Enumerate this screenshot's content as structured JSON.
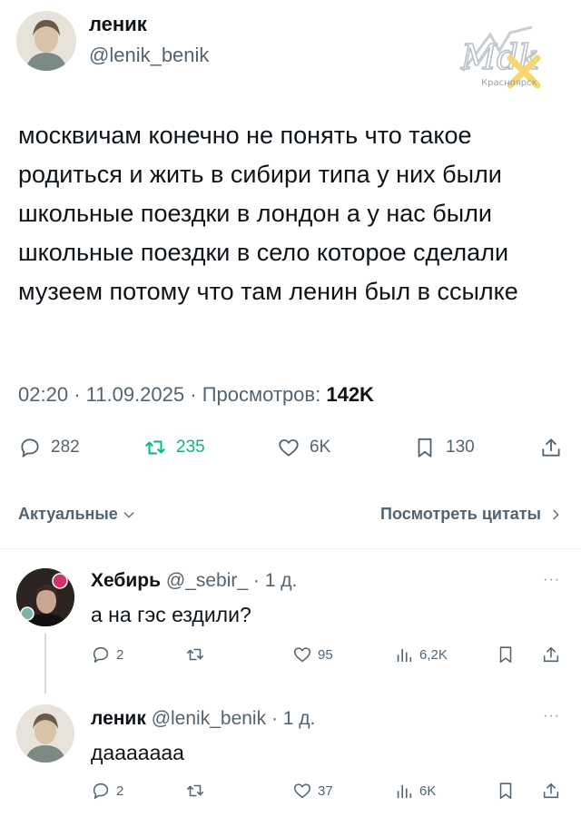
{
  "tweet": {
    "author_name": "леник",
    "author_handle": "@lenik_benik",
    "text": "москвичам конечно не понять что такое родиться и жить в сибири типа у них были школьные поездки в лондон а у нас были школьные поездки в село которое сделали музеем потому что там ленин был в ссылке",
    "time": "02:20",
    "date": "11.09.2025",
    "views_label": "Просмотров:",
    "views_count": "142K",
    "replies": "282",
    "retweets": "235",
    "likes": "6K",
    "bookmarks": "130"
  },
  "logo": {
    "wordmark": "Mdk",
    "city": "Красноярск"
  },
  "sort": {
    "left_label": "Актуальные",
    "right_label": "Посмотреть цитаты"
  },
  "replies": [
    {
      "name": "Хебирь",
      "handle": "@_sebir_",
      "time": "1 д.",
      "text": "а на гэс ездили?",
      "replies": "2",
      "retweets": "",
      "likes": "95",
      "views": "6,2K"
    },
    {
      "name": "леник",
      "handle": "@lenik_benik",
      "time": "1 д.",
      "text": "даааaaaa",
      "replies": "2",
      "retweets": "",
      "likes": "37",
      "views": "6K"
    }
  ],
  "ui": {
    "separator": "·",
    "more": "···"
  },
  "colors": {
    "retweet_active": "#00ba7c",
    "secondary_text": "#536471",
    "logo_accent": "#f5d76e"
  }
}
